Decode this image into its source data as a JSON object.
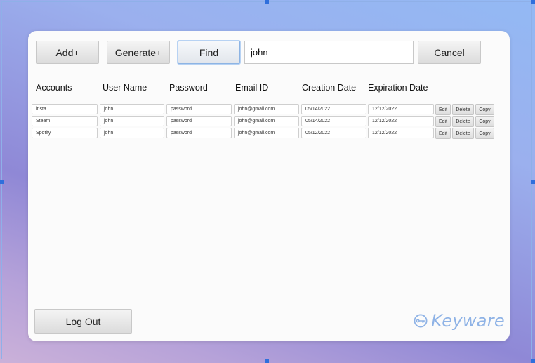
{
  "toolbar": {
    "add_label": "Add+",
    "generate_label": "Generate+",
    "find_label": "Find",
    "search_value": "john",
    "cancel_label": "Cancel"
  },
  "columns": [
    "Accounts",
    "User Name",
    "Password",
    "Email ID",
    "Creation Date",
    "Expiration Date"
  ],
  "rows": [
    {
      "account": "insta",
      "username": "john",
      "password": "password",
      "email": "john@gmail.com",
      "created": "05/14/2022",
      "expires": "12/12/2022"
    },
    {
      "account": "Steam",
      "username": "john",
      "password": "password",
      "email": "john@gmail.com",
      "created": "05/14/2022",
      "expires": "12/12/2022"
    },
    {
      "account": "Spotify",
      "username": "john",
      "password": "password",
      "email": "john@gmail.com",
      "created": "05/12/2022",
      "expires": "12/12/2022"
    }
  ],
  "row_actions": {
    "edit": "Edit",
    "delete": "Delete",
    "copy": "Copy"
  },
  "footer": {
    "logout_label": "Log Out",
    "brand": "Keyware",
    "brand_icon": "key-icon"
  },
  "colors": {
    "accent": "#8fb3e6",
    "selection_handle": "#2f6fdc"
  }
}
